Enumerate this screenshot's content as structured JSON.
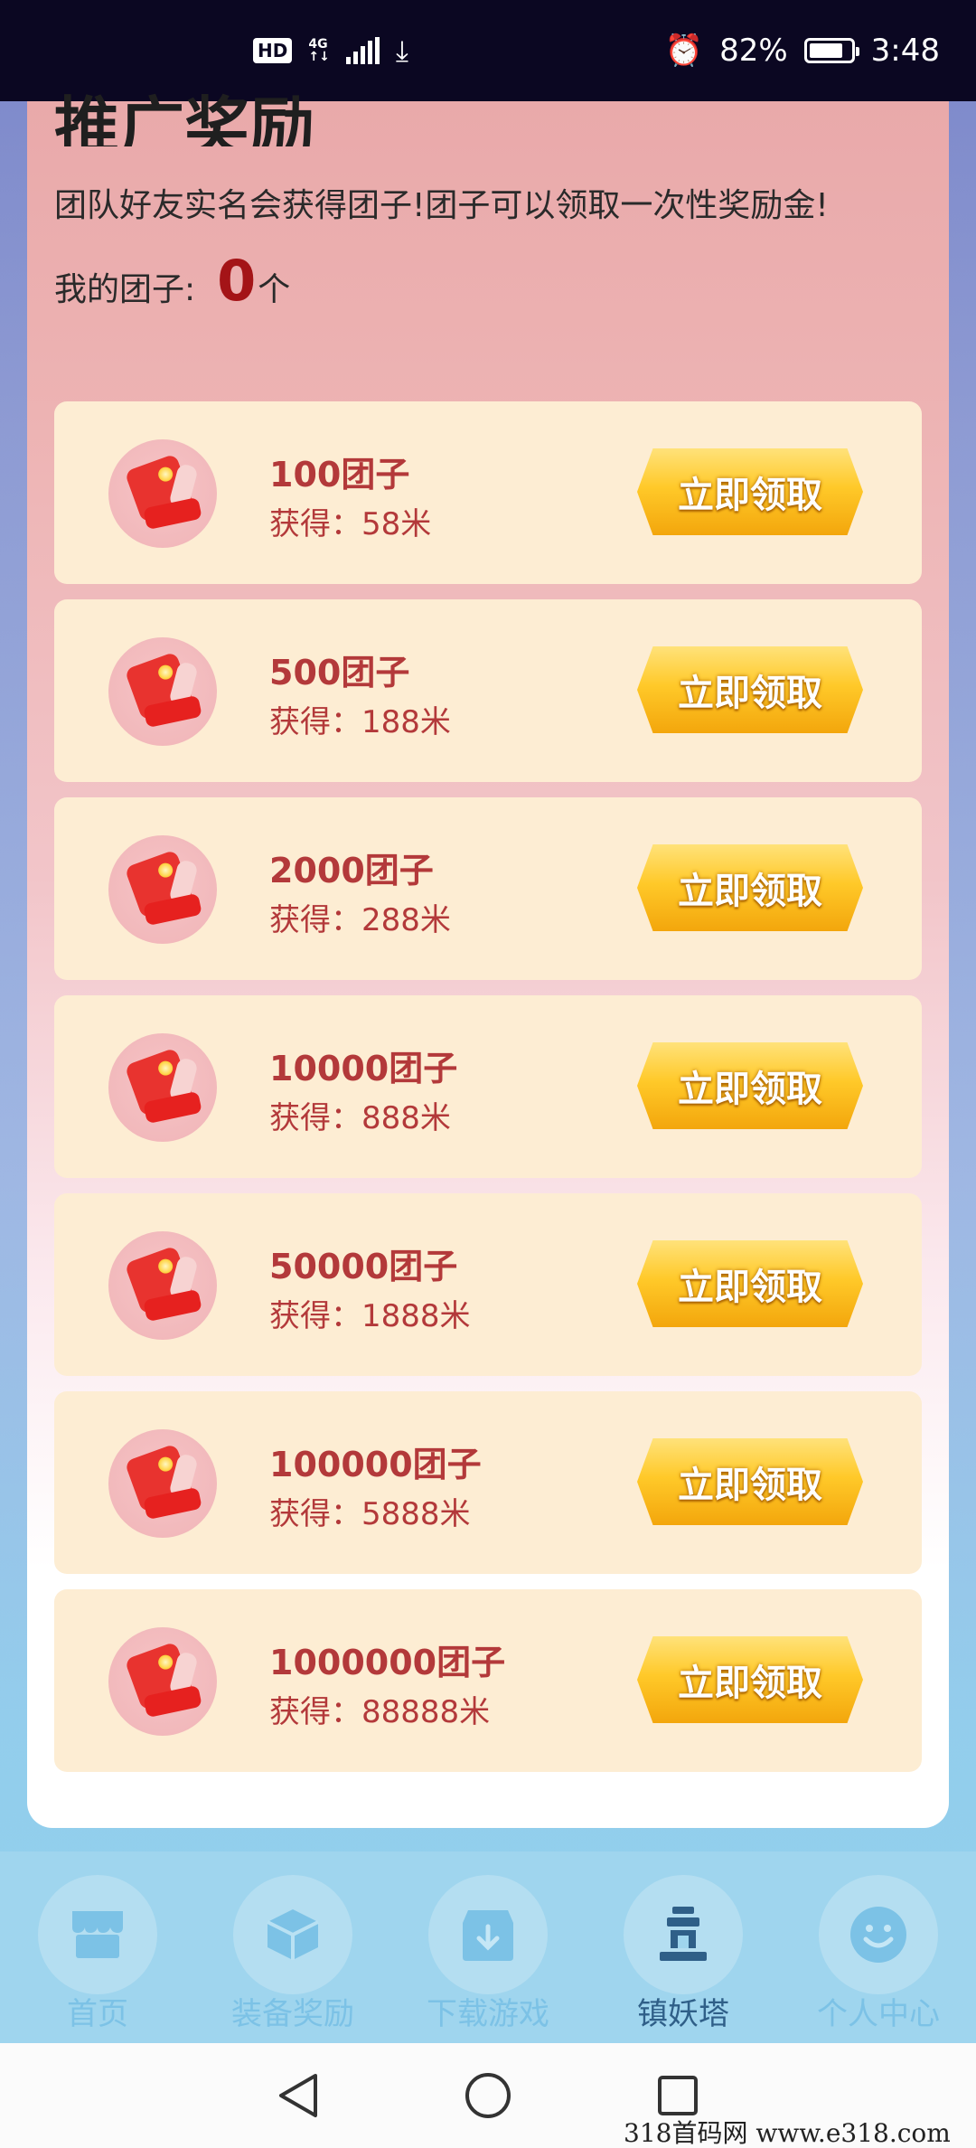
{
  "status_bar": {
    "hd": "HD",
    "network": "4G",
    "battery_percent": "82%",
    "time": "3:48",
    "battery_level": 0.82
  },
  "card": {
    "title": "推广奖励",
    "description": "团队好友实名会获得团子!团子可以领取一次性奖励金!",
    "my_label": "我的团子:",
    "my_count": "0",
    "my_unit": "个"
  },
  "rewards": [
    {
      "amount": "100团子",
      "gain": "获得：58米",
      "button": "立即领取"
    },
    {
      "amount": "500团子",
      "gain": "获得：188米",
      "button": "立即领取"
    },
    {
      "amount": "2000团子",
      "gain": "获得：288米",
      "button": "立即领取"
    },
    {
      "amount": "10000团子",
      "gain": "获得：888米",
      "button": "立即领取"
    },
    {
      "amount": "50000团子",
      "gain": "获得：1888米",
      "button": "立即领取"
    },
    {
      "amount": "100000团子",
      "gain": "获得：5888米",
      "button": "立即领取"
    },
    {
      "amount": "1000000团子",
      "gain": "获得：88888米",
      "button": "立即领取"
    }
  ],
  "bottom_nav": [
    {
      "label": "首页",
      "icon": "shop-icon",
      "active": false
    },
    {
      "label": "装备奖励",
      "icon": "box-icon",
      "active": false
    },
    {
      "label": "下载游戏",
      "icon": "download-icon",
      "active": false
    },
    {
      "label": "镇妖塔",
      "icon": "tower-icon",
      "active": true
    },
    {
      "label": "个人中心",
      "icon": "smile-icon",
      "active": false
    }
  ],
  "watermark": "318首码网 www.e318.com"
}
